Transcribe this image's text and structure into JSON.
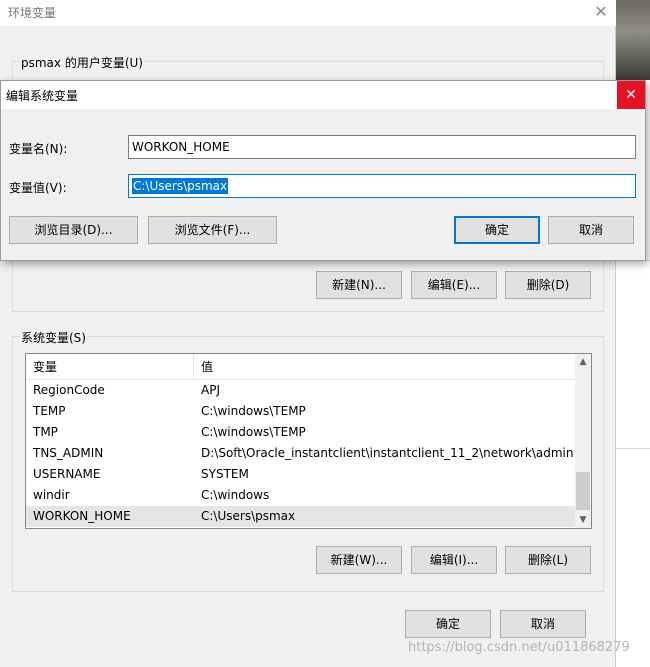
{
  "parent_window": {
    "title": "环境变量",
    "close_glyph": "✕",
    "user_vars_label": "psmax 的用户变量(U)",
    "user_buttons": {
      "new": "新建(N)...",
      "edit": "编辑(E)...",
      "delete": "删除(D)"
    },
    "system_vars_label": "系统变量(S)",
    "system_table": {
      "headers": [
        "变量",
        "值"
      ],
      "rows": [
        {
          "name": "RegionCode",
          "value": "APJ"
        },
        {
          "name": "TEMP",
          "value": "C:\\windows\\TEMP"
        },
        {
          "name": "TMP",
          "value": "C:\\windows\\TEMP"
        },
        {
          "name": "TNS_ADMIN",
          "value": "D:\\Soft\\Oracle_instantclient\\instantclient_11_2\\network\\admin"
        },
        {
          "name": "USERNAME",
          "value": "SYSTEM"
        },
        {
          "name": "windir",
          "value": "C:\\windows"
        },
        {
          "name": "WORKON_HOME",
          "value": "C:\\Users\\psmax"
        }
      ],
      "selected_row": "WORKON_HOME"
    },
    "system_buttons": {
      "new": "新建(W)...",
      "edit": "编辑(I)...",
      "delete": "删除(L)"
    },
    "footer_buttons": {
      "ok": "确定",
      "cancel": "取消"
    }
  },
  "edit_dialog": {
    "title": "编辑系统变量",
    "close_glyph": "✕",
    "name_label": "变量名(N):",
    "name_value": "WORKON_HOME",
    "value_label": "变量值(V):",
    "value_value": "C:\\Users\\psmax",
    "browse_dir": "浏览目录(D)...",
    "browse_file": "浏览文件(F)...",
    "ok": "确定",
    "cancel": "取消"
  },
  "watermark": "https://blog.csdn.net/u011868279",
  "colors": {
    "accent": "#0078d7",
    "close_red": "#e81123",
    "window_bg": "#f0f0f0"
  }
}
